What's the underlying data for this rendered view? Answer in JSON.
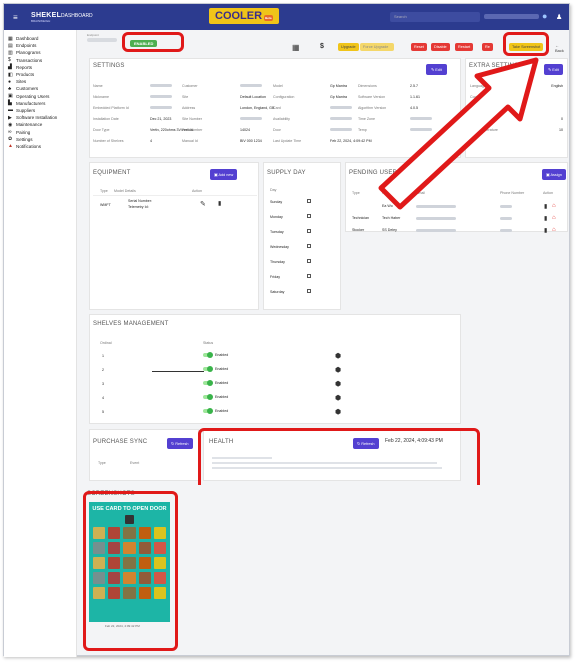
{
  "topbar": {
    "brand": "SHEKEL",
    "brand_sub": "BRAINWEIGH",
    "dashboard_label": "DASHBOARD",
    "cooler_label": "COOLER",
    "cooler_badge": "Beta",
    "search_placeholder": "Search"
  },
  "sidebar": {
    "items": [
      {
        "label": "Dashboard",
        "icon": "dashboard-icon",
        "glyph": "▦"
      },
      {
        "label": "Endpoints",
        "icon": "endpoints-icon",
        "glyph": "▤"
      },
      {
        "label": "Planograms",
        "icon": "planogram-icon",
        "glyph": "▥"
      },
      {
        "label": "Transactions",
        "icon": "dollar-icon",
        "glyph": "$"
      },
      {
        "label": "Reports",
        "icon": "reports-icon",
        "glyph": "▟"
      },
      {
        "label": "Products",
        "icon": "products-icon",
        "glyph": "◧"
      },
      {
        "label": "Sites",
        "icon": "location-icon",
        "glyph": "●"
      },
      {
        "label": "Customers",
        "icon": "customers-icon",
        "glyph": "♣"
      },
      {
        "label": "Operating Users",
        "icon": "users-icon",
        "glyph": "▣"
      },
      {
        "label": "Manufacturers",
        "icon": "factory-icon",
        "glyph": "▙"
      },
      {
        "label": "Suppliers",
        "icon": "truck-icon",
        "glyph": "▬"
      },
      {
        "label": "Software Installation",
        "icon": "play-icon",
        "glyph": "▶"
      },
      {
        "label": "Maintenance",
        "icon": "wrench-icon",
        "glyph": "◉"
      },
      {
        "label": "Pairing",
        "icon": "link-icon",
        "glyph": "∞"
      },
      {
        "label": "Settings",
        "icon": "gear-icon",
        "glyph": "✿"
      },
      {
        "label": "Notifications",
        "icon": "bell-icon",
        "glyph": "▲"
      }
    ]
  },
  "status": {
    "badge": "ENABLED",
    "small_label": "Endpoint"
  },
  "toolbar": {
    "dollar": "$",
    "buttons": [
      {
        "label": "Upgrade",
        "color": "#f0c419"
      },
      {
        "label": "Force Upgrade",
        "color": "#f4d76a"
      },
      {
        "label": "Reset",
        "color": "#e53935"
      },
      {
        "label": "Disable",
        "color": "#e53935"
      },
      {
        "label": "Restart",
        "color": "#e53935"
      },
      {
        "label": "Re",
        "color": "#e53935"
      },
      {
        "label": "Take Screenshot",
        "color": "#f0c419"
      }
    ],
    "back_label": "Back"
  },
  "settings": {
    "title": "SETTINGS",
    "edit_label": "Edit",
    "col1": [
      {
        "label": "Name",
        "value": ""
      },
      {
        "label": "Nickname",
        "value": ""
      },
      {
        "label": "Embedded Platform Id",
        "value": ""
      },
      {
        "label": "Installation Date",
        "value": "Dec 21, 2023"
      },
      {
        "label": "Door Type",
        "value": "Vertiv, 220ohms 3V/vertical"
      },
      {
        "label": "Number of Shelves",
        "value": "4"
      }
    ],
    "col2": [
      {
        "label": "Customer",
        "value": ""
      },
      {
        "label": "Site",
        "value": "Default Location"
      },
      {
        "label": "Address",
        "value": "London, England, GB"
      },
      {
        "label": "Site Number",
        "value": ""
      },
      {
        "label": "Part Number",
        "value": "14024"
      },
      {
        "label": "Manual Id",
        "value": "BIV 000 1234"
      }
    ],
    "col3": [
      {
        "label": "Model",
        "value": "Gp Mantra"
      },
      {
        "label": "Configuration",
        "value": "Gp Mantra"
      },
      {
        "label": "Card",
        "value": ""
      },
      {
        "label": "Availability",
        "value": ""
      },
      {
        "label": "Door",
        "value": ""
      },
      {
        "label": "Last Update Time",
        "value": "Feb 22, 2024, 4:09:42 PM"
      }
    ],
    "col4": [
      {
        "label": "Dimensions",
        "value": "2.5.7"
      },
      {
        "label": "Software Version",
        "value": "1.1.61"
      },
      {
        "label": "Algorithm Version",
        "value": "4.0.5"
      },
      {
        "label": "Time Zone",
        "value": ""
      },
      {
        "label": "Temp",
        "value": ""
      }
    ]
  },
  "extra_settings": {
    "title": "EXTRA SETTINGS",
    "edit_label": "Edit",
    "rows": [
      {
        "label": "Language",
        "value": "English"
      },
      {
        "label": "Cook Mode",
        "value": ""
      },
      {
        "label": "Cooler Plan",
        "value": ""
      },
      {
        "label": "Min Temperature",
        "value": "0"
      },
      {
        "label": "Max Temperature",
        "value": "10"
      }
    ]
  },
  "equipment": {
    "title": "EQUIPMENT",
    "add_label": "Add new",
    "headers": [
      "Type",
      "Model Details",
      "Action"
    ],
    "row": {
      "type": "WMFT",
      "serial": "Serial Number:",
      "telemetry": "Telemetry Id:"
    }
  },
  "supply_day": {
    "title": "SUPPLY DAY",
    "header": "Day",
    "days": [
      "Sunday",
      "Monday",
      "Tuesday",
      "Wednesday",
      "Thursday",
      "Friday",
      "Saturday"
    ]
  },
  "pending_user": {
    "title": "PENDING USER",
    "assign_label": "Assign",
    "headers": [
      "Type",
      "Name",
      "Email",
      "Phone Number",
      "Action"
    ],
    "rows": [
      {
        "type": "",
        "name": "Ea Wo"
      },
      {
        "type": "Technician",
        "name": "Tech Haber"
      },
      {
        "type": "Stocker",
        "name": "SS Deley"
      }
    ]
  },
  "shelves": {
    "title": "SHELVES MANAGEMENT",
    "headers": [
      "Ordinal",
      "Status"
    ],
    "rows": [
      {
        "ordinal": "1",
        "status": "Enabled"
      },
      {
        "ordinal": "2",
        "status": "Enabled"
      },
      {
        "ordinal": "3",
        "status": "Enabled"
      },
      {
        "ordinal": "4",
        "status": "Enabled"
      },
      {
        "ordinal": "5",
        "status": "Enabled"
      }
    ]
  },
  "purchase_sync": {
    "title": "PURCHASE SYNC",
    "refresh_label": "Refresh",
    "headers": [
      "Type",
      "Event"
    ]
  },
  "health": {
    "title": "HEALTH",
    "refresh_label": "Refresh",
    "timestamp": "Feb 22, 2024, 4:09:43 PM"
  },
  "screenshot": {
    "title": "SCREENSHOTS",
    "banner": "USE CARD TO OPEN DOOR",
    "caption": "Feb 22, 2024, 4:09:42 PM"
  },
  "colors": {
    "brand": "#2c3b8f",
    "accent": "#5340d1",
    "highlight": "#e01919",
    "yellow": "#f0c419",
    "screen": "#1db5a6"
  }
}
